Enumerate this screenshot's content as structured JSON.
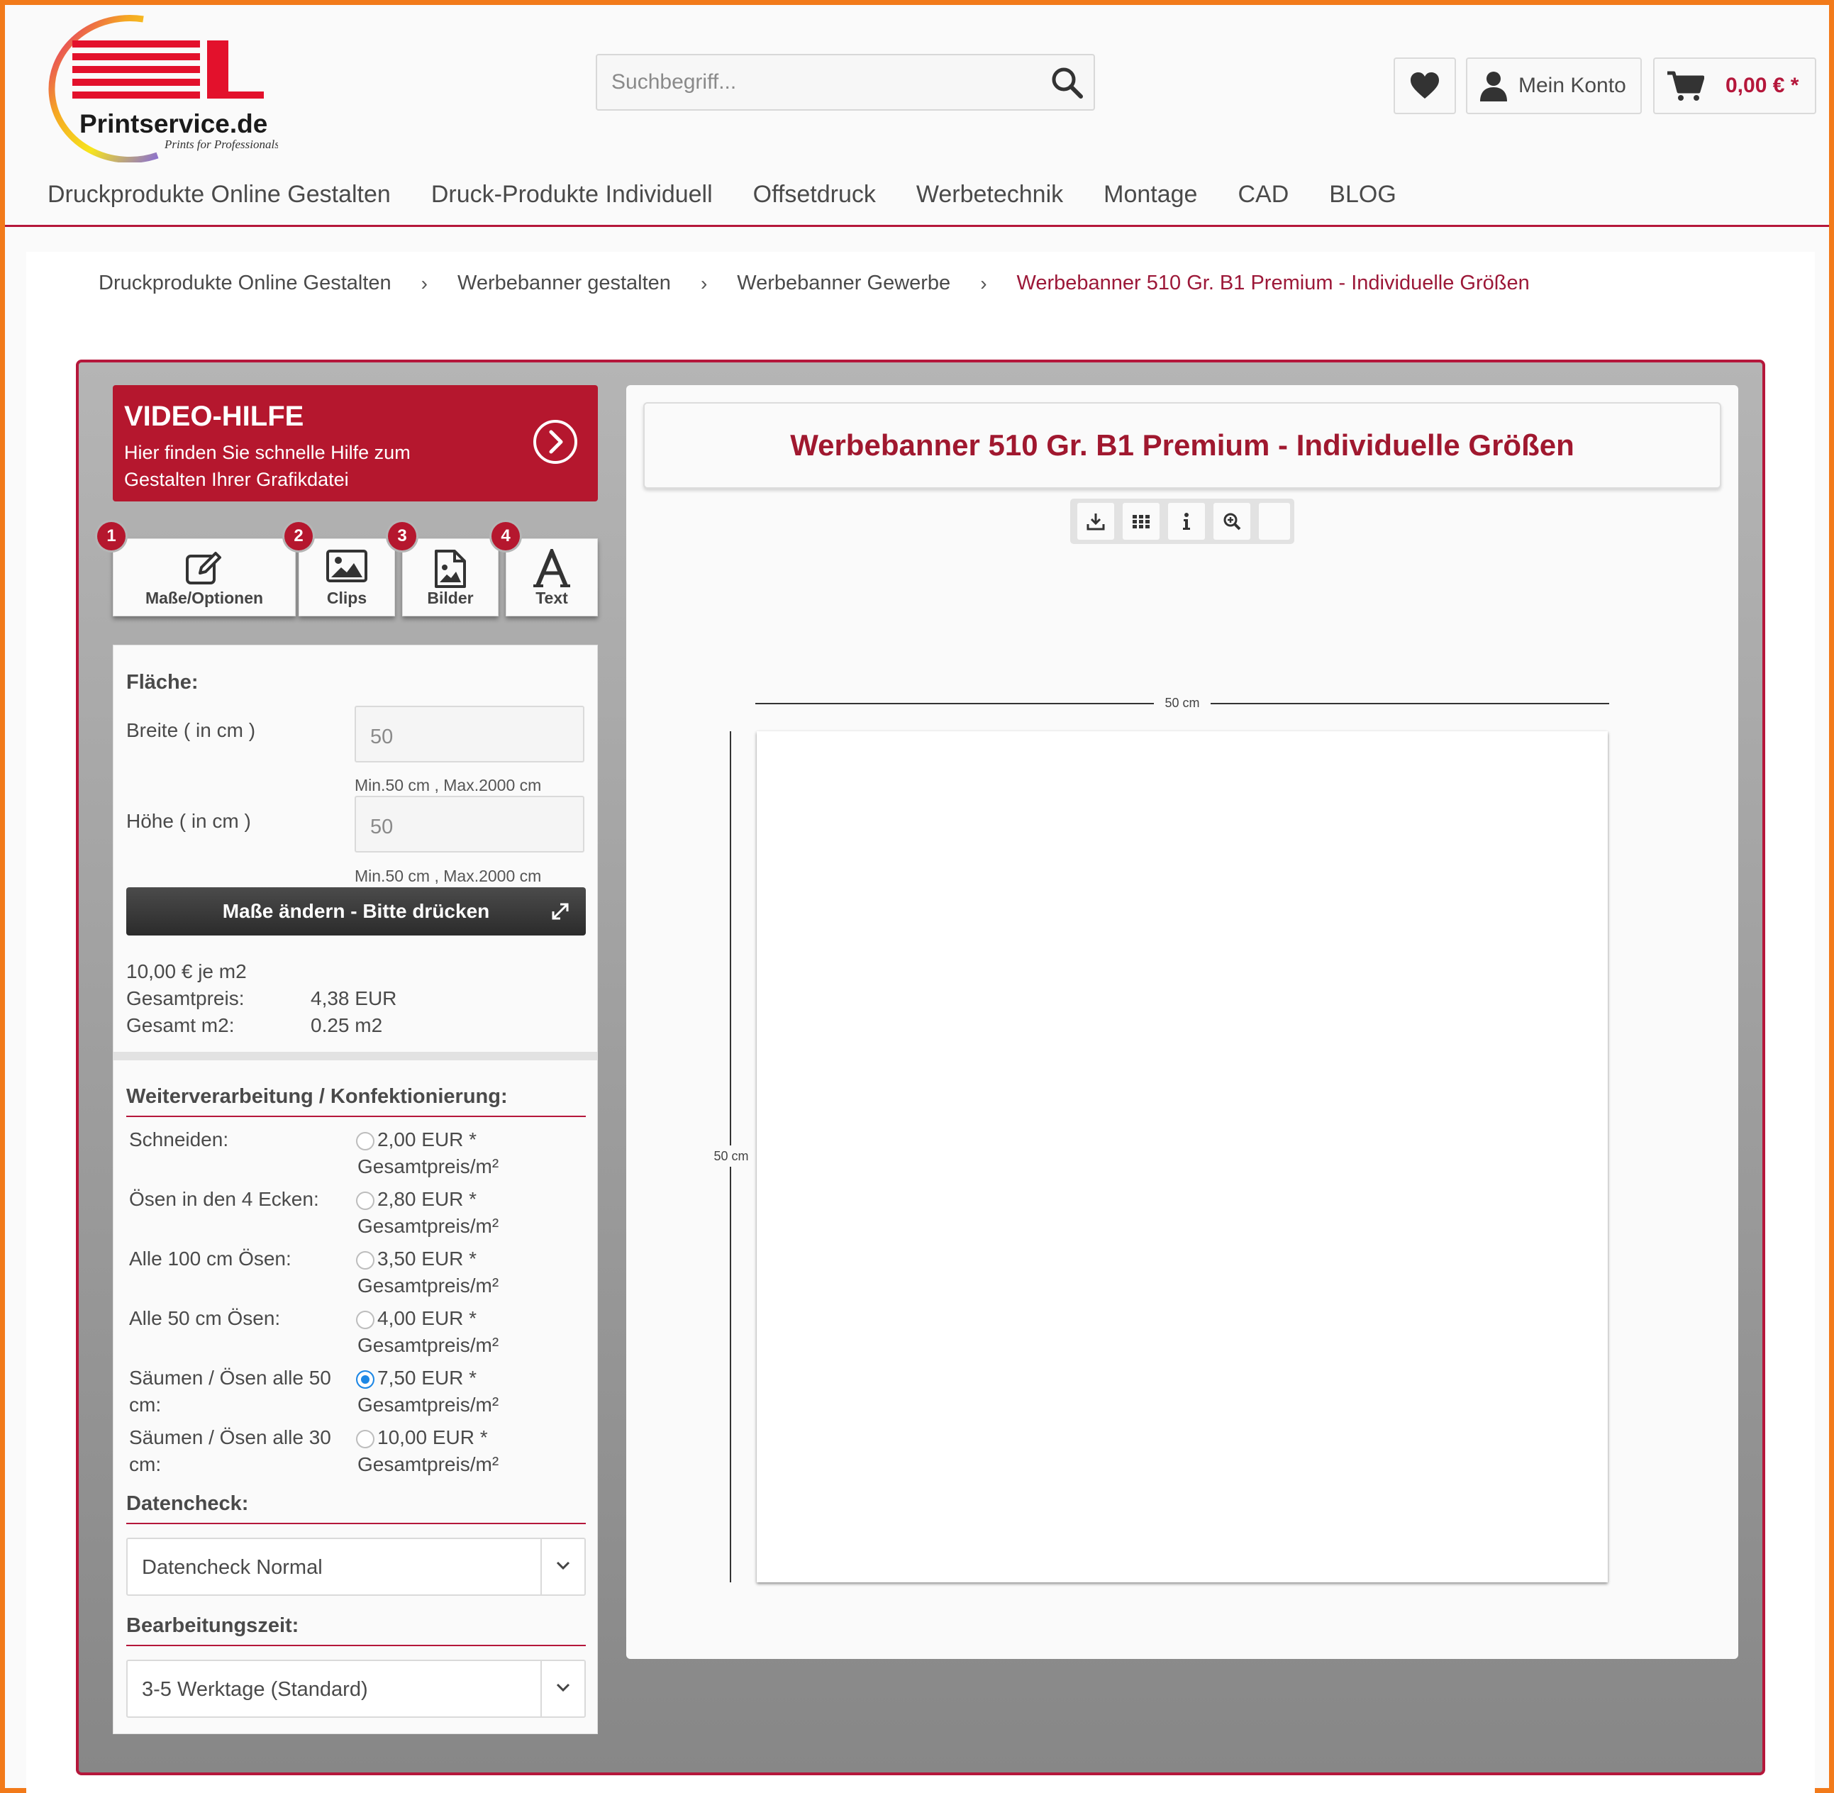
{
  "brand": {
    "logo_letters": "XL",
    "logo_name": "Printservice.de",
    "logo_tagline": "Prints for Professionals",
    "colors": {
      "accent": "#b5173b",
      "frame": "#f27a1a",
      "selected_radio": "#1e88e5"
    }
  },
  "header": {
    "search_placeholder": "Suchbegriff...",
    "account_label": "Mein Konto",
    "cart_amount": "0,00 € *"
  },
  "nav": [
    "Druckprodukte Online Gestalten",
    "Druck-Produkte Individuell",
    "Offsetdruck",
    "Werbetechnik",
    "Montage",
    "CAD",
    "BLOG"
  ],
  "breadcrumb": [
    "Druckprodukte Online Gestalten",
    "Werbebanner gestalten",
    "Werbebanner Gewerbe",
    "Werbebanner 510 Gr. B1 Premium - Individuelle Größen"
  ],
  "video_help": {
    "title": "VIDEO-HILFE",
    "subtitle": "Hier finden Sie schnelle Hilfe zum Gestalten Ihrer Grafikdatei"
  },
  "tabs": [
    {
      "num": "1",
      "label": "Maße/Optionen",
      "icon": "edit-icon"
    },
    {
      "num": "2",
      "label": "Clips",
      "icon": "image-icon"
    },
    {
      "num": "3",
      "label": "Bilder",
      "icon": "file-image-icon"
    },
    {
      "num": "4",
      "label": "Text",
      "icon": "text-icon"
    }
  ],
  "area": {
    "heading": "Fläche:",
    "width_label": "Breite ( in cm )",
    "width_value": "50",
    "width_hint": "Min.50 cm , Max.2000 cm",
    "height_label": "Höhe ( in cm )",
    "height_value": "50",
    "height_hint": "Min.50 cm , Max.2000 cm",
    "button_label": "Maße ändern - Bitte drücken"
  },
  "pricing": {
    "per_m2": "10,00 € je m2",
    "total_label": "Gesamtpreis:",
    "total_value": "4,38 EUR",
    "m2_label": "Gesamt m2:",
    "m2_value": "0.25  m2"
  },
  "finishing": {
    "heading": "Weiterverarbeitung / Konfektionierung:",
    "unit": "Gesamtpreis/m²",
    "options": [
      {
        "label": "Schneiden:",
        "price": "2,00 EUR *",
        "selected": false
      },
      {
        "label": "Ösen in den 4 Ecken:",
        "price": "2,80 EUR *",
        "selected": false
      },
      {
        "label": "Alle 100 cm Ösen:",
        "price": "3,50 EUR *",
        "selected": false
      },
      {
        "label": "Alle 50 cm Ösen:",
        "price": "4,00 EUR *",
        "selected": false
      },
      {
        "label": "Säumen / Ösen alle 50 cm:",
        "price": "7,50 EUR *",
        "selected": true
      },
      {
        "label": "Säumen / Ösen alle 30 cm:",
        "price": "10,00 EUR *",
        "selected": false
      }
    ]
  },
  "datacheck": {
    "heading": "Datencheck:",
    "value": "Datencheck Normal"
  },
  "processing": {
    "heading": "Bearbeitungszeit:",
    "value": "3-5 Werktage (Standard)"
  },
  "canvas": {
    "title": "Werbebanner 510 Gr. B1 Premium - Individuelle Größen",
    "width_label": "50 cm",
    "height_label": "50 cm",
    "tools": [
      "download-icon",
      "grid-icon",
      "info-icon",
      "zoom-icon",
      "blank-tool"
    ]
  }
}
